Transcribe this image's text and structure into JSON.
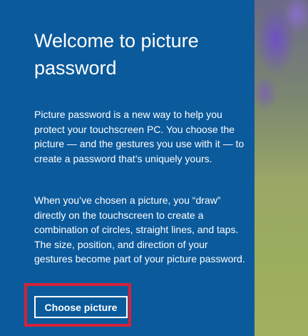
{
  "panel": {
    "title": "Welcome to picture password",
    "paragraph_1": "Picture password is a new way to help you protect your touchscreen PC. You choose the picture — and the gestures you use with it — to create a password that’s uniquely yours.",
    "paragraph_2": "When you’ve chosen a picture, you “draw” directly on the touchscreen to create a combination of circles, straight lines, and taps. The size, position, and direction of your gestures become part of your picture password.",
    "choose_button_label": "Choose picture"
  },
  "colors": {
    "panel_background": "#0b5a9c",
    "text": "#ffffff",
    "highlight_border": "#d3223a"
  }
}
